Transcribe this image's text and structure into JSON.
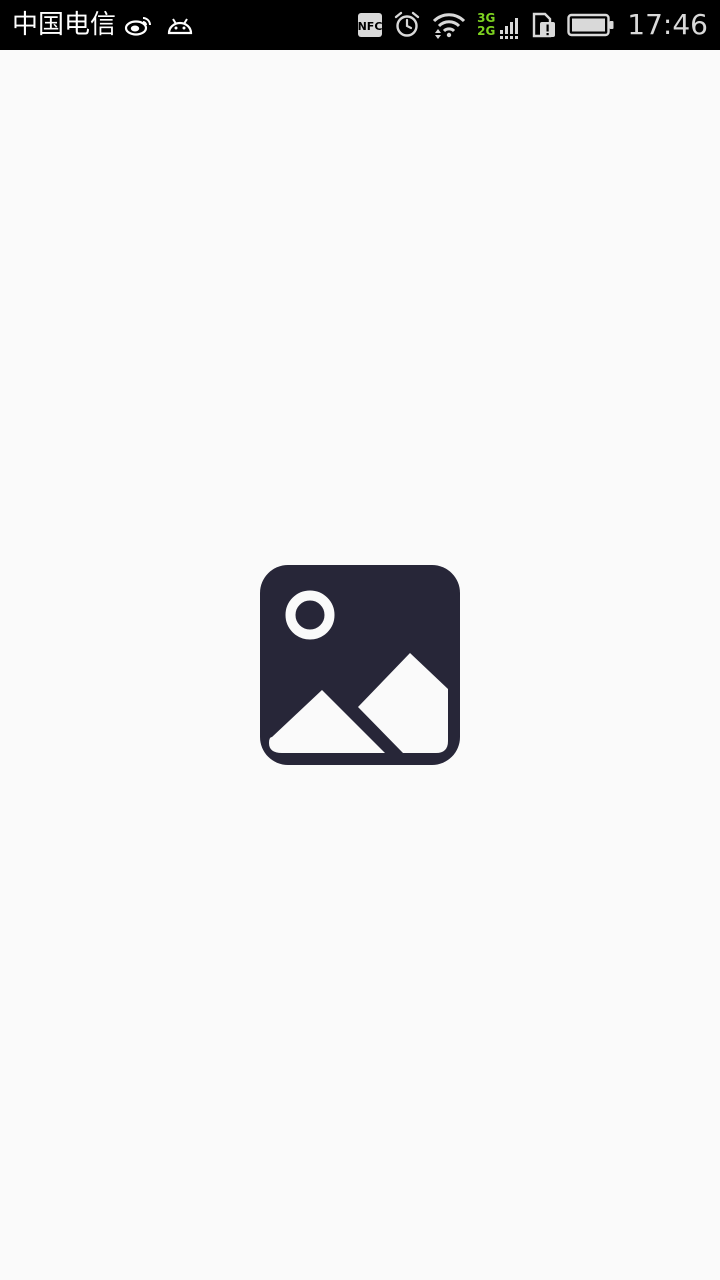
{
  "status_bar": {
    "carrier": "中国电信",
    "time": "17:46",
    "network_badges": [
      "3G",
      "2G"
    ],
    "nfc_label": "NFC",
    "icons": [
      "weibo-icon",
      "android-icon",
      "nfc-icon",
      "alarm-icon",
      "wifi-icon",
      "cell-signal-icon",
      "sim-alert-icon",
      "battery-icon"
    ]
  },
  "main": {
    "image_placeholder_icon": "image-placeholder-icon"
  },
  "colors": {
    "status_bar_bg": "#000000",
    "background": "#fafafa",
    "placeholder_bg": "#272638",
    "network_badge": "#7ed321"
  }
}
